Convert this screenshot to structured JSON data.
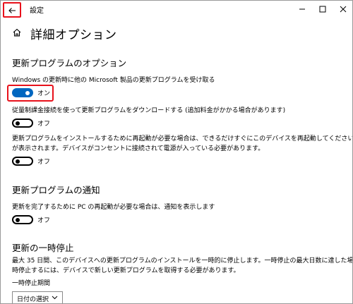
{
  "window": {
    "title": "設定"
  },
  "page": {
    "title": "詳細オプション"
  },
  "sections": {
    "update_options": {
      "title": "更新プログラムのオプション",
      "opt1": {
        "label": "Windows の更新時に他の Microsoft 製品の更新プログラムを受け取る",
        "state": "オン"
      },
      "opt2": {
        "label": "従量制課金接続を使って更新プログラムをダウンロードする (追加料金がかかる場合があります)",
        "state": "オフ"
      },
      "opt3": {
        "label_line1": "更新プログラムをインストールするために再起動が必要な場合は、できるだけすぐにこのデバイスを再起動してください。再起動の前に通知",
        "label_line2": "が表示されます。デバイスがコンセントに接続されて電源が入っている必要があります。",
        "state": "オフ"
      }
    },
    "notifications": {
      "title": "更新プログラムの通知",
      "opt1": {
        "label": "更新を完了するために PC の再起動が必要な場合は、通知を表示します",
        "state": "オフ"
      }
    },
    "pause": {
      "title": "更新の一時停止",
      "desc_line1": "最大 35 日間、このデバイスへの更新プログラムのインストールを一時的に停止します。一時停止の最大日数に達した場合、もう一度一",
      "desc_line2": "時停止するには、デバイスで新しい更新プログラムを取得する必要があります。",
      "period_label": "一時停止期間",
      "dropdown_value": "日付の選択"
    }
  },
  "colors": {
    "accent": "#0067c0",
    "highlight": "#e8111b"
  }
}
